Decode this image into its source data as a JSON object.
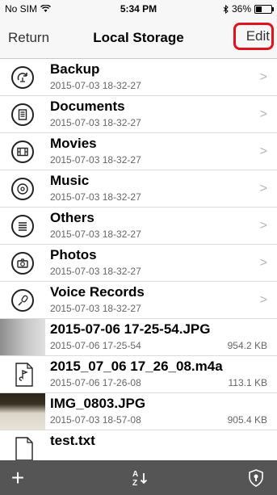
{
  "status": {
    "carrier": "No SIM",
    "wifi_icon": "wifi-icon",
    "time": "5:34 PM",
    "bt_icon": "bluetooth-icon",
    "battery": "36%",
    "battery_level": 0.36
  },
  "nav": {
    "back": "Return",
    "title": "Local Storage",
    "edit": "Edit",
    "edit_highlight_color": "#e0131c"
  },
  "folders": [
    {
      "name": "Backup",
      "date": "2015-07-03 18-32-27",
      "icon": "backup-icon"
    },
    {
      "name": "Documents",
      "date": "2015-07-03 18-32-27",
      "icon": "documents-icon"
    },
    {
      "name": "Movies",
      "date": "2015-07-03 18-32-27",
      "icon": "film-icon"
    },
    {
      "name": "Music",
      "date": "2015-07-03 18-32-27",
      "icon": "music-icon"
    },
    {
      "name": "Others",
      "date": "2015-07-03 18-32-27",
      "icon": "others-icon"
    },
    {
      "name": "Photos",
      "date": "2015-07-03 18-32-27",
      "icon": "camera-icon"
    },
    {
      "name": "Voice Records",
      "date": "2015-07-03 18-32-27",
      "icon": "microphone-icon"
    }
  ],
  "files": [
    {
      "name": "2015-07-06 17-25-54.JPG",
      "date": "2015-07-06 17-25-54",
      "size": "954.2 KB",
      "kind": "image"
    },
    {
      "name": "2015_07_06 17_26_08.m4a",
      "date": "2015-07-06 17-26-08",
      "size": "113.1 KB",
      "kind": "audio"
    },
    {
      "name": "IMG_0803.JPG",
      "date": "2015-07-03 18-57-08",
      "size": "905.4 KB",
      "kind": "image2"
    },
    {
      "name": "test.txt",
      "date": "",
      "size": "",
      "kind": "text"
    }
  ],
  "toolbar": {
    "add": "+",
    "sort": "A-Z sort",
    "shield_icon": "shield-icon"
  }
}
